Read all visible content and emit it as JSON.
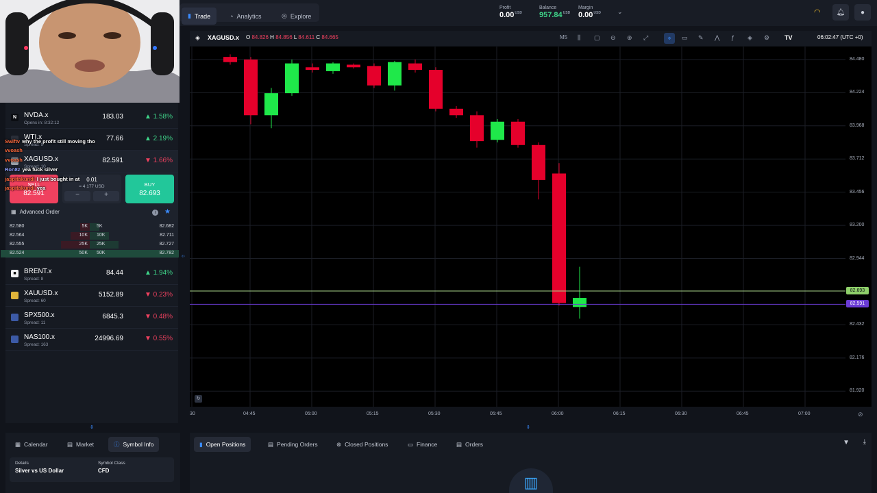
{
  "nav": {
    "tabs": [
      {
        "label": "Trade",
        "icon": "bar-chart-icon",
        "active": true
      },
      {
        "label": "Analytics",
        "icon": "analytics-icon",
        "active": false
      },
      {
        "label": "Explore",
        "icon": "compass-icon",
        "active": false
      }
    ]
  },
  "account": {
    "profit_label": "Profit",
    "profit_value": "0.00",
    "profit_ccy": "USD",
    "balance_label": "Balance",
    "balance_value": "957.84",
    "balance_ccy": "USD",
    "margin_label": "Margin",
    "margin_value": "0.00",
    "margin_ccy": "USD"
  },
  "chart_header": {
    "symbol": "XAGUSD.x",
    "o_label": "O",
    "o": "84.826",
    "h_label": "H",
    "h": "84.856",
    "l_label": "L",
    "l": "84.611",
    "c_label": "C",
    "c": "84.665",
    "timeframe": "M5",
    "clock": "06:02:47 (UTC +0)"
  },
  "watchlist": [
    {
      "name": "NVDA.x",
      "sub": "Opens in: 8:32:12",
      "price": "183.03",
      "change": "1.58%",
      "dir": "up",
      "logo": "N",
      "logo_bg": "#0b0d12",
      "logo_fg": "#fff"
    },
    {
      "name": "WTI.x",
      "sub": "Spread: 9",
      "price": "77.66",
      "change": "2.19%",
      "dir": "up",
      "logo": "",
      "logo_bg": "#2a2e38",
      "logo_fg": "#fff"
    },
    {
      "name": "XAGUSD.x",
      "sub": "Spread: 10",
      "price": "82.591",
      "change": "1.66%",
      "dir": "down",
      "logo": "",
      "logo_bg": "#9aa0a8",
      "logo_fg": "#fff"
    }
  ],
  "trade_panel": {
    "sell_label": "SELL",
    "sell_price": "82.591",
    "buy_label": "BUY",
    "buy_price": "82.693",
    "qty": "0.01",
    "qty_value": "≈ 4 177 USD",
    "minus": "−",
    "plus": "+",
    "advanced_label": "Advanced Order"
  },
  "orderbook": [
    {
      "bid": "82.580",
      "bid_vol": "5K",
      "ask_vol": "5K",
      "ask": "82.682"
    },
    {
      "bid": "82.564",
      "bid_vol": "10K",
      "ask_vol": "10K",
      "ask": "82.711"
    },
    {
      "bid": "82.555",
      "bid_vol": "25K",
      "ask_vol": "25K",
      "ask": "82.727"
    },
    {
      "bid": "82.524",
      "bid_vol": "50K",
      "ask_vol": "50K",
      "ask": "82.782"
    }
  ],
  "watchlist2": [
    {
      "name": "BRENT.x",
      "sub": "Spread: 8",
      "price": "84.44",
      "change": "1.94%",
      "dir": "up",
      "logo": "■",
      "logo_bg": "#f1f2f4",
      "logo_fg": "#000"
    },
    {
      "name": "XAUUSD.x",
      "sub": "Spread: 60",
      "price": "5152.89",
      "change": "0.23%",
      "dir": "down",
      "logo": "",
      "logo_bg": "#e0b43a",
      "logo_fg": "#000"
    },
    {
      "name": "SPX500.x",
      "sub": "Spread: 11",
      "price": "6845.3",
      "change": "0.48%",
      "dir": "down",
      "logo": "",
      "logo_bg": "#3c5aa6",
      "logo_fg": "#fff"
    },
    {
      "name": "NAS100.x",
      "sub": "Spread: 163",
      "price": "24996.69",
      "change": "0.55%",
      "dir": "down",
      "logo": "",
      "logo_bg": "#3c5aa6",
      "logo_fg": "#fff"
    }
  ],
  "chat": [
    {
      "user": "Swiftv",
      "text": "why the profit still moving tho",
      "color": "#ff6a3d"
    },
    {
      "user": "vvoash",
      "text": "",
      "color": "#ff6a3d"
    },
    {
      "user": "vvoash",
      "text": "",
      "color": "#ff6a3d"
    },
    {
      "user": "Ron8z",
      "text": "yea fuck silver",
      "color": "#8fa0ff"
    },
    {
      "user": "jaspitakundi",
      "text": "I just bought in at",
      "color": "#ff6a3d"
    },
    {
      "user": "jaspitakundi",
      "text": "yea",
      "color": "#ff6a3d"
    }
  ],
  "y_axis": [
    "84.480",
    "84.224",
    "83.968",
    "83.712",
    "83.456",
    "83.200",
    "82.944",
    "82.432",
    "82.176",
    "81.920"
  ],
  "price_tags": {
    "ask": "82.693",
    "bid": "82.591"
  },
  "x_axis": [
    "30",
    "04:45",
    "05:00",
    "05:15",
    "05:30",
    "05:45",
    "06:00",
    "06:15",
    "06:30",
    "06:45",
    "07:00"
  ],
  "candles": [
    {
      "o": 84.5,
      "c": 84.46,
      "h": 84.52,
      "l": 84.44
    },
    {
      "o": 84.48,
      "c": 84.05,
      "h": 84.5,
      "l": 83.98
    },
    {
      "o": 84.05,
      "c": 84.22,
      "h": 84.26,
      "l": 83.95
    },
    {
      "o": 84.22,
      "c": 84.45,
      "h": 84.48,
      "l": 84.2
    },
    {
      "o": 84.42,
      "c": 84.4,
      "h": 84.45,
      "l": 84.38
    },
    {
      "o": 84.39,
      "c": 84.45,
      "h": 84.46,
      "l": 84.37
    },
    {
      "o": 84.44,
      "c": 84.42,
      "h": 84.45,
      "l": 84.41
    },
    {
      "o": 84.43,
      "c": 84.28,
      "h": 84.45,
      "l": 84.26
    },
    {
      "o": 84.28,
      "c": 84.46,
      "h": 84.47,
      "l": 84.24
    },
    {
      "o": 84.45,
      "c": 84.4,
      "h": 84.48,
      "l": 84.38
    },
    {
      "o": 84.4,
      "c": 84.1,
      "h": 84.42,
      "l": 84.08
    },
    {
      "o": 84.1,
      "c": 84.05,
      "h": 84.12,
      "l": 84.03
    },
    {
      "o": 84.05,
      "c": 83.85,
      "h": 84.08,
      "l": 83.8
    },
    {
      "o": 83.86,
      "c": 84.0,
      "h": 84.02,
      "l": 83.84
    },
    {
      "o": 84.0,
      "c": 83.82,
      "h": 84.02,
      "l": 83.8
    },
    {
      "o": 83.82,
      "c": 83.55,
      "h": 83.84,
      "l": 83.4
    },
    {
      "o": 83.6,
      "c": 82.6,
      "h": 83.68,
      "l": 82.58
    },
    {
      "o": 82.57,
      "c": 82.64,
      "h": 82.88,
      "l": 82.48
    }
  ],
  "bottom_left_tabs": [
    {
      "label": "Calendar",
      "icon": "calendar-icon",
      "active": false
    },
    {
      "label": "Market",
      "icon": "market-icon",
      "active": false
    },
    {
      "label": "Symbol Info",
      "icon": "info-icon",
      "active": true
    }
  ],
  "symbol_info": {
    "details_label": "Details",
    "details_value": "Silver vs US Dollar",
    "class_label": "Symbol Class",
    "class_value": "CFD"
  },
  "bottom_right_tabs": [
    {
      "label": "Open Positions",
      "icon": "positions-icon",
      "active": true
    },
    {
      "label": "Pending Orders",
      "icon": "pending-icon",
      "active": false
    },
    {
      "label": "Closed Positions",
      "icon": "closed-icon",
      "active": false
    },
    {
      "label": "Finance",
      "icon": "finance-icon",
      "active": false
    },
    {
      "label": "Orders",
      "icon": "orders-icon",
      "active": false
    }
  ],
  "colors": {
    "up": "#1fe84a",
    "down": "#e5002b",
    "accent": "#3b8cff",
    "balance": "#3fd68a"
  }
}
